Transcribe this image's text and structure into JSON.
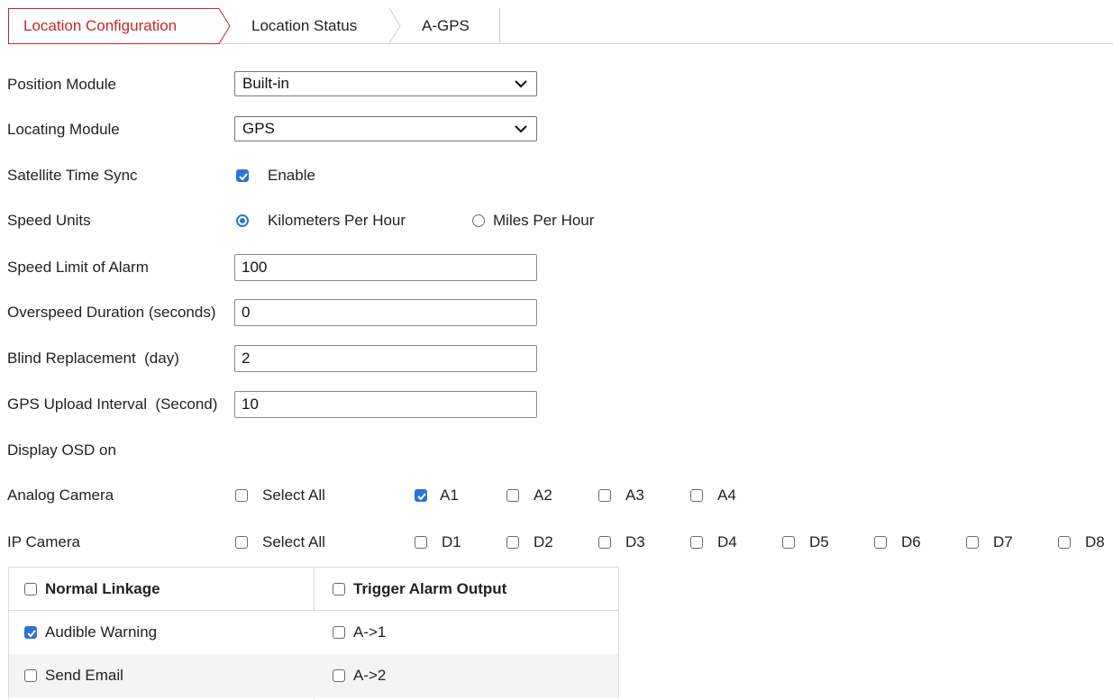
{
  "tabs": [
    {
      "label": "Location Configuration",
      "active": true
    },
    {
      "label": "Location Status",
      "active": false
    },
    {
      "label": "A-GPS",
      "active": false
    }
  ],
  "accent_color": "#c8262d",
  "check_color": "#2b74d6",
  "form": {
    "position_module": {
      "label": "Position Module",
      "value": "Built-in"
    },
    "locating_module": {
      "label": "Locating Module",
      "value": "GPS"
    },
    "satellite_time_sync": {
      "label": "Satellite Time Sync",
      "option": "Enable",
      "checked": true
    },
    "speed_units": {
      "label": "Speed Units",
      "options": [
        "Kilometers Per Hour",
        "Miles Per Hour"
      ],
      "selected": "Kilometers Per Hour"
    },
    "speed_limit": {
      "label": "Speed Limit of Alarm",
      "value": "100"
    },
    "overspeed_duration": {
      "label": "Overspeed Duration (seconds)",
      "value": "0"
    },
    "blind_replacement": {
      "label": "Blind Replacement  (day)",
      "value": "2"
    },
    "gps_upload_interval": {
      "label": "GPS Upload Interval  (Second)",
      "value": "10"
    },
    "display_osd": {
      "label": "Display OSD on"
    },
    "analog_camera": {
      "label": "Analog Camera",
      "select_all": "Select All",
      "channels": [
        {
          "name": "A1",
          "checked": true
        },
        {
          "name": "A2",
          "checked": false
        },
        {
          "name": "A3",
          "checked": false
        },
        {
          "name": "A4",
          "checked": false
        }
      ]
    },
    "ip_camera": {
      "label": "IP Camera",
      "select_all": "Select All",
      "channels": [
        {
          "name": "D1",
          "checked": false
        },
        {
          "name": "D2",
          "checked": false
        },
        {
          "name": "D3",
          "checked": false
        },
        {
          "name": "D4",
          "checked": false
        },
        {
          "name": "D5",
          "checked": false
        },
        {
          "name": "D6",
          "checked": false
        },
        {
          "name": "D7",
          "checked": false
        },
        {
          "name": "D8",
          "checked": false
        }
      ]
    }
  },
  "linkage": {
    "normal_header": "Normal Linkage",
    "alarm_header": "Trigger Alarm Output",
    "normal_items": [
      {
        "label": "Audible Warning",
        "checked": true
      },
      {
        "label": "Send Email",
        "checked": false
      }
    ],
    "alarm_items": [
      {
        "label": "A->1",
        "checked": false
      },
      {
        "label": "A->2",
        "checked": false
      }
    ]
  }
}
